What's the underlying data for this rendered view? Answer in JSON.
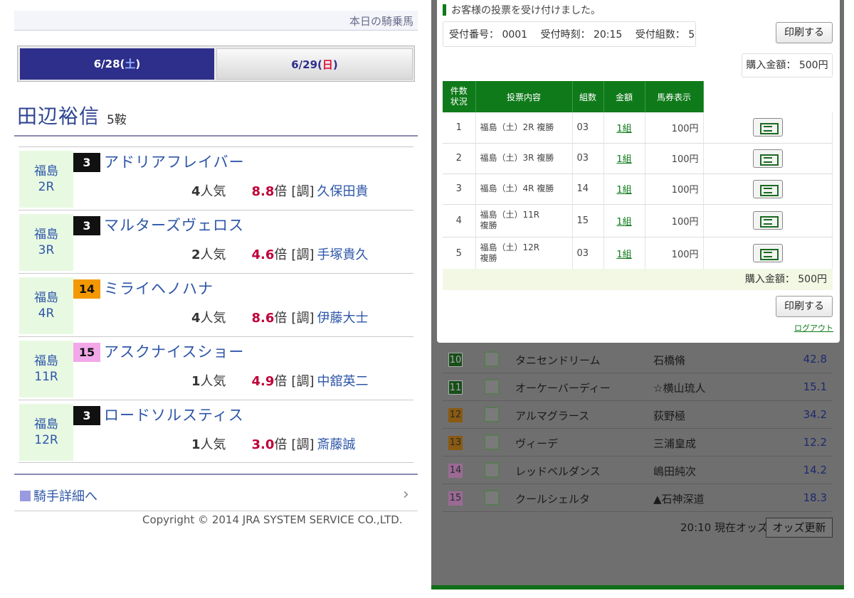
{
  "left": {
    "today_label": "本日の騎乗馬",
    "tabs": [
      {
        "date": "6/28",
        "day": "土",
        "label_prefix": "6/28(",
        "label_suffix": ")"
      },
      {
        "date": "6/29",
        "day": "日",
        "label_prefix": "6/29(",
        "label_suffix": ")"
      }
    ],
    "jockey_name": "田辺裕信",
    "ride_count": "5鞍",
    "rides": [
      {
        "venue": "福島",
        "race": "2R",
        "number": "3",
        "horse": "アドリアフレイバー",
        "pop": "4",
        "pop_unit": "人気",
        "odds": "8.8",
        "odds_unit": "倍",
        "trainer_tag": "[調]",
        "trainer": "久保田貴"
      },
      {
        "venue": "福島",
        "race": "3R",
        "number": "3",
        "horse": "マルターズヴェロス",
        "pop": "2",
        "pop_unit": "人気",
        "odds": "4.6",
        "odds_unit": "倍",
        "trainer_tag": "[調]",
        "trainer": "手塚貴久"
      },
      {
        "venue": "福島",
        "race": "4R",
        "number": "14",
        "horse": "ミライヘノハナ",
        "pop": "4",
        "pop_unit": "人気",
        "odds": "8.6",
        "odds_unit": "倍",
        "trainer_tag": "[調]",
        "trainer": "伊藤大士"
      },
      {
        "venue": "福島",
        "race": "11R",
        "number": "15",
        "horse": "アスクナイスショー",
        "pop": "1",
        "pop_unit": "人気",
        "odds": "4.9",
        "odds_unit": "倍",
        "trainer_tag": "[調]",
        "trainer": "中舘英二"
      },
      {
        "venue": "福島",
        "race": "12R",
        "number": "3",
        "horse": "ロードソルスティス",
        "pop": "1",
        "pop_unit": "人気",
        "odds": "3.0",
        "odds_unit": "倍",
        "trainer_tag": "[調]",
        "trainer": "斎藤誠"
      }
    ],
    "detail_link": "騎手詳細へ",
    "copyright": "Copyright © 2014 JRA SYSTEM SERVICE CO.,LTD."
  },
  "right": {
    "modal": {
      "message": "お客様の投票を受け付けました。",
      "info": {
        "receipt_no": "受付番号： 0001",
        "receipt_time": "受付時刻： 20:15",
        "receipt_sets": "受付組数： 5"
      },
      "print_label": "印刷する",
      "total_top": "購入金額： 500円",
      "columns": [
        "件数\n状況",
        "投票内容",
        "組数",
        "金額",
        "馬券表示"
      ],
      "col_count_l1": "件数",
      "col_count_l2": "状況",
      "bets": [
        {
          "no": "1",
          "content": "福島（土）2R 複勝",
          "combo": "03",
          "sets": "1組",
          "amount": "100円"
        },
        {
          "no": "2",
          "content": "福島（土）3R 複勝",
          "combo": "03",
          "sets": "1組",
          "amount": "100円"
        },
        {
          "no": "3",
          "content": "福島（土）4R 複勝",
          "combo": "14",
          "sets": "1組",
          "amount": "100円"
        },
        {
          "no": "4",
          "content": "福島（土）11R",
          "content2": "複勝",
          "combo": "15",
          "sets": "1組",
          "amount": "100円"
        },
        {
          "no": "5",
          "content": "福島（土）12R",
          "content2": "複勝",
          "combo": "03",
          "sets": "1組",
          "amount": "100円"
        }
      ],
      "total_bottom": "購入金額： 500円",
      "logout": "ログアウト"
    },
    "odds_rows": [
      {
        "no": "10",
        "horse": "タニセンドリーム",
        "jockey": "石橋脩",
        "odds": "42.8",
        "color": "g"
      },
      {
        "no": "11",
        "horse": "オーケーバーディー",
        "jockey": "☆横山琉人",
        "odds": "15.1",
        "color": "g"
      },
      {
        "no": "12",
        "horse": "アルマグラース",
        "jockey": "荻野極",
        "odds": "34.2",
        "color": "o"
      },
      {
        "no": "13",
        "horse": "ヴィーデ",
        "jockey": "三浦皇成",
        "odds": "12.2",
        "color": "o"
      },
      {
        "no": "14",
        "horse": "レッドベルダンス",
        "jockey": "嶋田純次",
        "odds": "14.2",
        "color": "p"
      },
      {
        "no": "15",
        "horse": "クールシェルタ",
        "jockey": "▲石神深道",
        "odds": "18.3",
        "color": "p"
      }
    ],
    "odds_time": "20:10 現在オッズ",
    "odds_update": "オッズ更新"
  }
}
